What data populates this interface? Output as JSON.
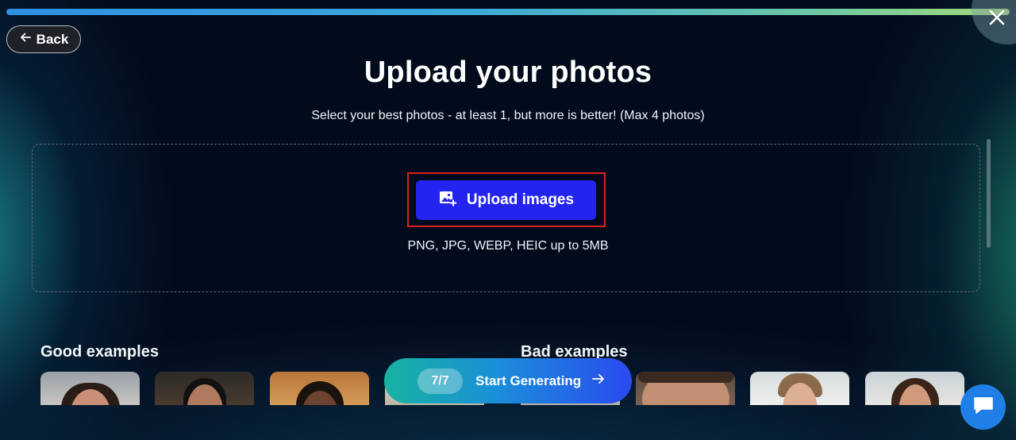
{
  "progress": {
    "fraction": 1.0
  },
  "nav": {
    "back_label": "Back"
  },
  "header": {
    "title": "Upload your photos",
    "subtitle": "Select your best photos - at least 1, but more is better! (Max 4 photos)"
  },
  "upload": {
    "button_label": "Upload images",
    "formats": "PNG, JPG, WEBP, HEIC up to 5MB"
  },
  "examples": {
    "good_heading": "Good examples",
    "bad_heading": "Bad examples"
  },
  "generate": {
    "count": "7/7",
    "label": "Start Generating"
  },
  "colors": {
    "accent_blue": "#2424f0",
    "highlight_red": "#e0201f",
    "chat_blue": "#1f7fe6"
  },
  "icons": [
    "close-icon",
    "arrow-left-icon",
    "image-plus-icon",
    "arrow-right-icon",
    "chat-icon"
  ]
}
